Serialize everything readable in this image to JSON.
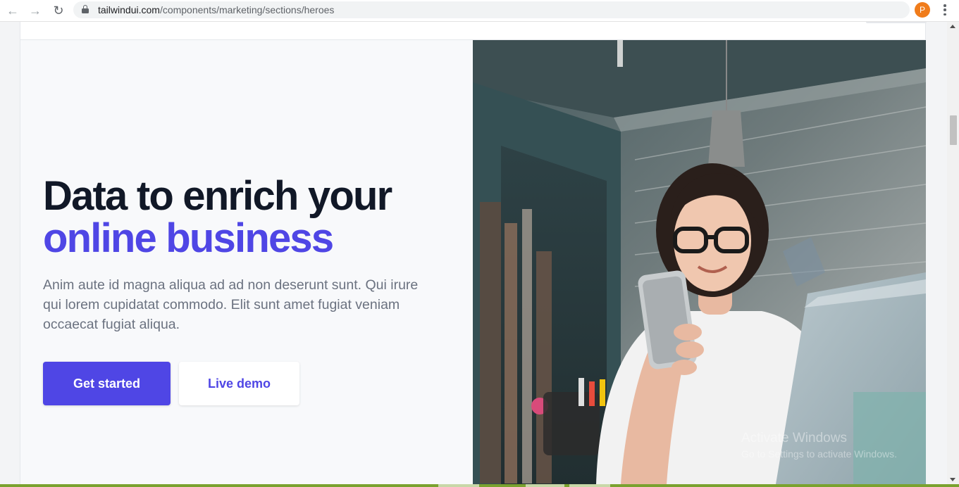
{
  "browser": {
    "url_host": "tailwindui.com",
    "url_path": "/components/marketing/sections/heroes",
    "back_icon": "←",
    "forward_icon": "→",
    "reload_icon": "↻",
    "star_icon": "☆",
    "profile_initial": "P",
    "profile_color": "#f07c1b"
  },
  "hero": {
    "headline_line1": "Data to enrich your",
    "headline_line2": "online business",
    "description": "Anim aute id magna aliqua ad ad non deserunt sunt. Qui irure qui lorem cupidatat commodo. Elit sunt amet fugiat veniam occaecat fugiat aliqua.",
    "primary_button": "Get started",
    "secondary_button": "Live demo",
    "accent_color": "#4f46e5",
    "heading_color": "#111827"
  },
  "overlay": {
    "activate_title": "Activate Windows",
    "activate_sub": "Go to Settings to activate Windows."
  }
}
